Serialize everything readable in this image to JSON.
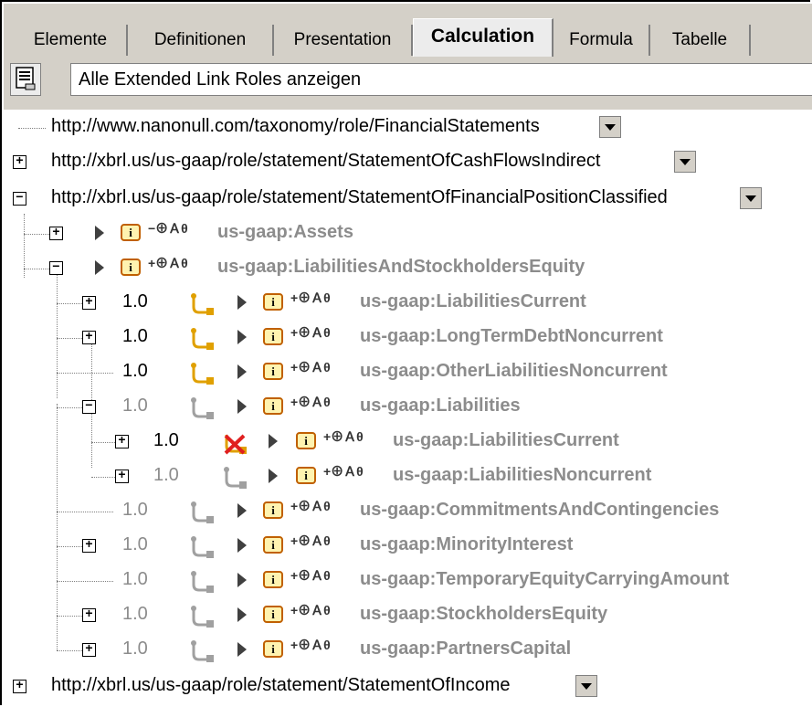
{
  "tabs": [
    {
      "label": "Elemente"
    },
    {
      "label": "Definitionen"
    },
    {
      "label": "Presentation"
    },
    {
      "label": "Calculation"
    },
    {
      "label": "Formula"
    },
    {
      "label": "Tabelle"
    }
  ],
  "active_tab": "Calculation",
  "toolbar": {
    "combo_value": "Alle Extended Link Roles anzeigen",
    "button_icon": "list-view-icon"
  },
  "tree": {
    "roles": [
      {
        "uri": "http://www.nanonull.com/taxonomy/role/FinancialStatements"
      },
      {
        "uri": "http://xbrl.us/us-gaap/role/statement/StatementOfCashFlowsIndirect"
      },
      {
        "uri": "http://xbrl.us/us-gaap/role/statement/StatementOfFinancialPositionClassified"
      },
      {
        "uri": "http://xbrl.us/us-gaap/role/statement/StatementOfIncome"
      }
    ],
    "nodes": [
      {
        "flags": "−⊕Ａθ",
        "name": "us-gaap:Assets"
      },
      {
        "flags": "+⊕Ａθ",
        "name": "us-gaap:LiabilitiesAndStockholdersEquity"
      },
      {
        "weight": "1.0",
        "flags": "+⊕Ａθ",
        "name": "us-gaap:LiabilitiesCurrent"
      },
      {
        "weight": "1.0",
        "flags": "+⊕Ａθ",
        "name": "us-gaap:LongTermDebtNoncurrent"
      },
      {
        "weight": "1.0",
        "flags": "+⊕Ａθ",
        "name": "us-gaap:OtherLiabilitiesNoncurrent"
      },
      {
        "weight": "1.0",
        "flags": "+⊕Ａθ",
        "name": "us-gaap:Liabilities"
      },
      {
        "weight": "1.0",
        "flags": "+⊕Ａθ",
        "name": "us-gaap:LiabilitiesCurrent"
      },
      {
        "weight": "1.0",
        "flags": "+⊕Ａθ",
        "name": "us-gaap:LiabilitiesNoncurrent"
      },
      {
        "weight": "1.0",
        "flags": "+⊕Ａθ",
        "name": "us-gaap:CommitmentsAndContingencies"
      },
      {
        "weight": "1.0",
        "flags": "+⊕Ａθ",
        "name": "us-gaap:MinorityInterest"
      },
      {
        "weight": "1.0",
        "flags": "+⊕Ａθ",
        "name": "us-gaap:TemporaryEquityCarryingAmount"
      },
      {
        "weight": "1.0",
        "flags": "+⊕Ａθ",
        "name": "us-gaap:StockholdersEquity"
      },
      {
        "weight": "1.0",
        "flags": "+⊕Ａθ",
        "name": "us-gaap:PartnersCapital"
      }
    ]
  },
  "colors": {
    "ui_gray": "#d4d0c8",
    "element_text": "#8c8c8c",
    "arc_active": "#e0a000",
    "prohibit": "#e02020"
  }
}
